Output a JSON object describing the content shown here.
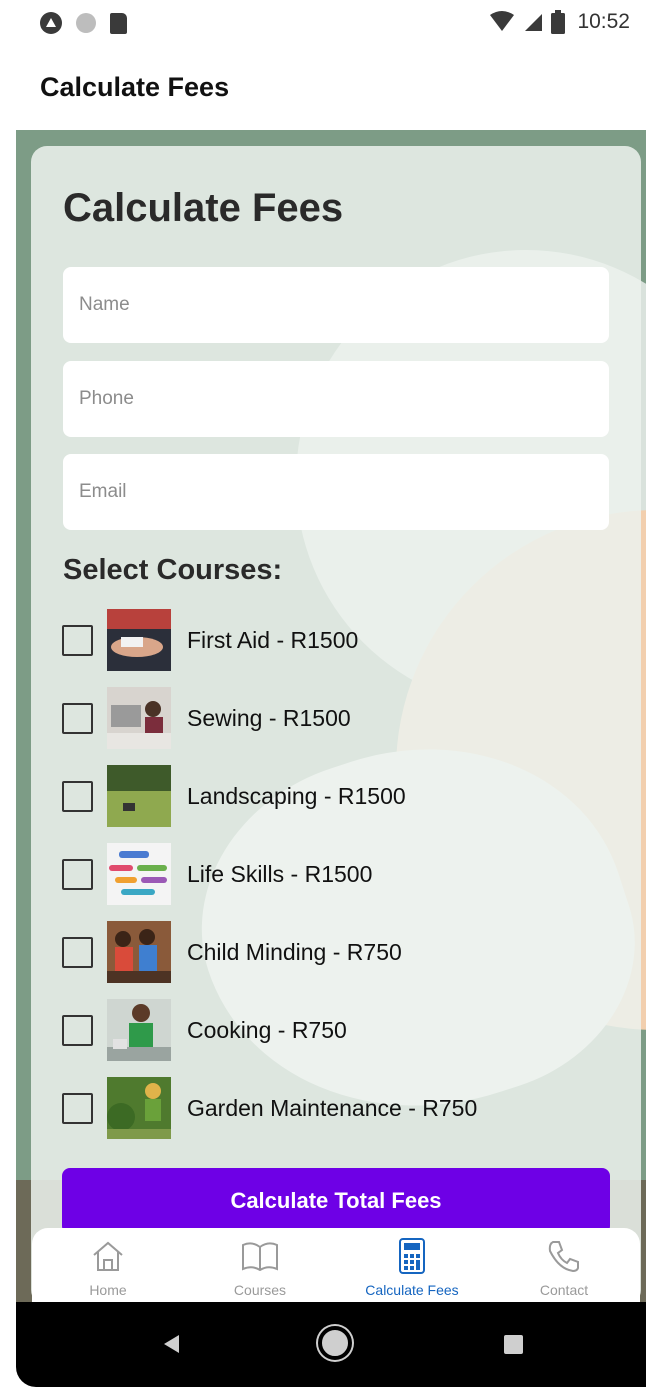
{
  "status_bar": {
    "time": "10:52",
    "icons": [
      "app-a-icon",
      "circle-dot-icon",
      "sd-card-icon",
      "wifi-icon",
      "cellular-signal-icon",
      "battery-icon"
    ]
  },
  "app_bar": {
    "title": "Calculate Fees"
  },
  "form": {
    "heading": "Calculate Fees",
    "name": {
      "placeholder": "Name",
      "value": ""
    },
    "phone": {
      "placeholder": "Phone",
      "value": ""
    },
    "email": {
      "placeholder": "Email",
      "value": ""
    },
    "courses_label": "Select Courses:",
    "courses": [
      {
        "label": "First Aid - R1500",
        "checked": false
      },
      {
        "label": "Sewing - R1500",
        "checked": false
      },
      {
        "label": "Landscaping - R1500",
        "checked": false
      },
      {
        "label": "Life Skills - R1500",
        "checked": false
      },
      {
        "label": "Child Minding - R750",
        "checked": false
      },
      {
        "label": "Cooking - R750",
        "checked": false
      },
      {
        "label": "Garden Maintenance - R750",
        "checked": false
      }
    ],
    "submit_label": "Calculate Total Fees"
  },
  "bottom_nav": {
    "items": [
      {
        "label": "Home",
        "icon": "home-icon",
        "active": false
      },
      {
        "label": "Courses",
        "icon": "book-icon",
        "active": false
      },
      {
        "label": "Calculate Fees",
        "icon": "calculator-icon",
        "active": true
      },
      {
        "label": "Contact",
        "icon": "phone-icon",
        "active": false
      }
    ]
  },
  "colors": {
    "accent": "#6e00e6",
    "active_nav": "#1565c0",
    "background": "#7d9c86"
  }
}
